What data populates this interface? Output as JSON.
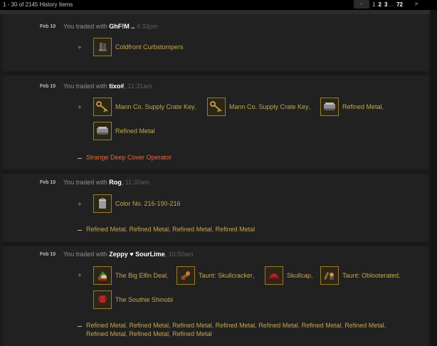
{
  "header": {
    "range_text": "1 - 30 of 2145 History Items",
    "prev_label": "<",
    "pages": [
      "1",
      "2",
      "3",
      "...",
      "72"
    ],
    "next_label": ">"
  },
  "trades": [
    {
      "date": "Feb 10",
      "prefix": "You traded with ",
      "user": "GhF!M ..",
      "time": "4:33pm",
      "received": [
        {
          "name": "Coldfront Curbstompers",
          "icon": "boots-icon",
          "comma": ""
        }
      ],
      "given": []
    },
    {
      "date": "Feb 10",
      "prefix": "You traded with ",
      "user": "tixo#",
      "time": "11:31am",
      "received": [
        {
          "name": "Mann Co. Supply Crate Key",
          "icon": "key-icon",
          "comma": ","
        },
        {
          "name": "Mann Co. Supply Crate Key",
          "icon": "key-icon",
          "comma": ","
        },
        {
          "name": "Refined Metal",
          "icon": "metal-icon",
          "comma": ","
        },
        {
          "name": "Refined Metal",
          "icon": "metal-icon",
          "comma": ""
        }
      ],
      "given": [
        {
          "name": "Strange Deep Cover Operator"
        }
      ]
    },
    {
      "date": "Feb 10",
      "prefix": "You traded with ",
      "user": "Rog",
      "time": "11:30am",
      "received": [
        {
          "name": "Color No. 216-190-216",
          "icon": "paint-can-icon",
          "comma": ""
        }
      ],
      "given_line": [
        "Refined Metal",
        "Refined Metal",
        "Refined Metal",
        "Refined Metal"
      ]
    },
    {
      "date": "Feb 10",
      "prefix": "You traded with ",
      "user": "Zeppy ♥ SourLime",
      "time": "10:50am",
      "received": [
        {
          "name": "The Big Elfin Deal",
          "icon": "elf-hat-icon",
          "comma": ","
        },
        {
          "name": "Taunt: Skullcracker",
          "icon": "taunt-icon",
          "comma": ","
        },
        {
          "name": "Skullcap",
          "icon": "cap-icon",
          "comma": ","
        },
        {
          "name": "Taunt: Oblooterated",
          "icon": "taunt-icon",
          "comma": ","
        },
        {
          "name": "The Southie Shinobi",
          "icon": "ninja-outfit-icon",
          "comma": ""
        }
      ],
      "given_line_1": [
        "Refined Metal",
        "Refined Metal",
        "Refined Metal",
        "Refined Metal",
        "Refined Metal",
        "Refined Metal",
        "Refined Metal"
      ],
      "given_line_2": [
        "Refined Metal",
        "Refined Metal",
        "Refined Metal"
      ]
    }
  ]
}
